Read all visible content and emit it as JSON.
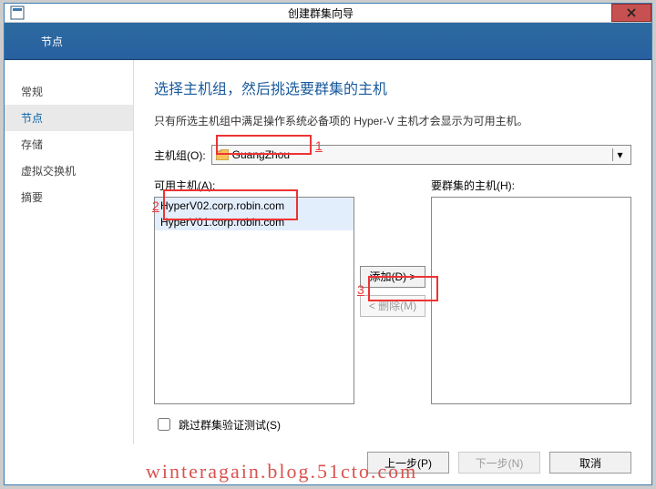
{
  "titlebar": {
    "title": "创建群集向导"
  },
  "header": {
    "heading": "节点"
  },
  "sidebar": {
    "items": [
      {
        "label": "常规"
      },
      {
        "label": "节点"
      },
      {
        "label": "存储"
      },
      {
        "label": "虚拟交换机"
      },
      {
        "label": "摘要"
      }
    ]
  },
  "main": {
    "heading": "选择主机组，然后挑选要群集的主机",
    "description": "只有所选主机组中满足操作系统必备项的 Hyper-V 主机才会显示为可用主机。",
    "hostgroup_label": "主机组(O):",
    "hostgroup_value": "GuangZhou",
    "available_label": "可用主机(A):",
    "available_hosts": [
      "HyperV02.corp.robin.com",
      "HyperV01.corp.robin.com"
    ],
    "cluster_label": "要群集的主机(H):",
    "add_label": "添加(D) >",
    "remove_label": "< 删除(M)",
    "skip_label": "跳过群集验证测试(S)"
  },
  "footer": {
    "prev": "上一步(P)",
    "next": "下一步(N)",
    "cancel": "取消"
  },
  "annotations": {
    "n1": "1",
    "n2": "2",
    "n3": "3"
  },
  "watermark": "winteragain.blog.51cto.com"
}
